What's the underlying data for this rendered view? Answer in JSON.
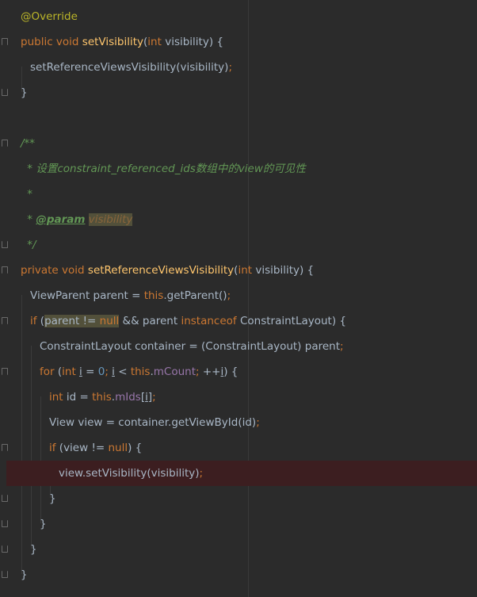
{
  "lines": [
    {
      "tokens": [
        {
          "t": "@Override",
          "c": "ann"
        }
      ]
    },
    {
      "tokens": [
        {
          "t": "public ",
          "c": "kw"
        },
        {
          "t": "void ",
          "c": "kw"
        },
        {
          "t": "setVisibility",
          "c": "fn"
        },
        {
          "t": "(",
          "c": ""
        },
        {
          "t": "int ",
          "c": "kw"
        },
        {
          "t": "visibility) {",
          "c": ""
        }
      ]
    },
    {
      "tokens": [
        {
          "t": "setReferenceViewsVisibility(visibility)",
          "c": ""
        },
        {
          "t": ";",
          "c": "kw"
        }
      ]
    },
    {
      "tokens": [
        {
          "t": "}",
          "c": ""
        }
      ]
    },
    {
      "tokens": []
    },
    {
      "tokens": [
        {
          "t": "/**",
          "c": "doc"
        }
      ]
    },
    {
      "tokens": [
        {
          "t": " * 设置constraint_referenced_ids数组中的view的可见性",
          "c": "doc"
        }
      ]
    },
    {
      "tokens": [
        {
          "t": " *",
          "c": "doc"
        }
      ]
    },
    {
      "tokens": [
        {
          "t": " * ",
          "c": "doc"
        },
        {
          "t": "@param",
          "c": "doctag"
        },
        {
          "t": " ",
          "c": "doc"
        },
        {
          "t": "visibility",
          "c": "docval hl"
        }
      ]
    },
    {
      "tokens": [
        {
          "t": " */",
          "c": "doc"
        }
      ]
    },
    {
      "tokens": [
        {
          "t": "private ",
          "c": "kw"
        },
        {
          "t": "void ",
          "c": "kw"
        },
        {
          "t": "setReferenceViewsVisibility",
          "c": "fn"
        },
        {
          "t": "(",
          "c": ""
        },
        {
          "t": "int ",
          "c": "kw"
        },
        {
          "t": "visibility) {",
          "c": ""
        }
      ]
    },
    {
      "tokens": [
        {
          "t": "ViewParent parent = ",
          "c": ""
        },
        {
          "t": "this",
          "c": "kw"
        },
        {
          "t": ".getParent()",
          "c": ""
        },
        {
          "t": ";",
          "c": "kw"
        }
      ]
    },
    {
      "tokens": [
        {
          "t": "if ",
          "c": "kw"
        },
        {
          "t": "(",
          "c": ""
        },
        {
          "t": "parent != ",
          "c": "hl"
        },
        {
          "t": "null",
          "c": "kw hl"
        },
        {
          "t": " && parent ",
          "c": ""
        },
        {
          "t": "instanceof ",
          "c": "kw"
        },
        {
          "t": "ConstraintLayout) {",
          "c": ""
        }
      ]
    },
    {
      "tokens": [
        {
          "t": "ConstraintLayout container = (ConstraintLayout) parent",
          "c": ""
        },
        {
          "t": ";",
          "c": "kw"
        }
      ]
    },
    {
      "tokens": [
        {
          "t": "for ",
          "c": "kw"
        },
        {
          "t": "(",
          "c": ""
        },
        {
          "t": "int ",
          "c": "kw"
        },
        {
          "t": "i",
          "c": "ul"
        },
        {
          "t": " = ",
          "c": ""
        },
        {
          "t": "0",
          "c": "num"
        },
        {
          "t": "; ",
          "c": "kw"
        },
        {
          "t": "i",
          "c": "ul"
        },
        {
          "t": " < ",
          "c": ""
        },
        {
          "t": "this",
          "c": "kw"
        },
        {
          "t": ".",
          "c": ""
        },
        {
          "t": "mCount",
          "c": "field"
        },
        {
          "t": "; ",
          "c": "kw"
        },
        {
          "t": "++",
          "c": ""
        },
        {
          "t": "i",
          "c": "ul"
        },
        {
          "t": ") {",
          "c": ""
        }
      ]
    },
    {
      "tokens": [
        {
          "t": "int ",
          "c": "kw"
        },
        {
          "t": "id = ",
          "c": ""
        },
        {
          "t": "this",
          "c": "kw"
        },
        {
          "t": ".",
          "c": ""
        },
        {
          "t": "mIds",
          "c": "field"
        },
        {
          "t": "[",
          "c": ""
        },
        {
          "t": "i",
          "c": "ul"
        },
        {
          "t": "]",
          "c": ""
        },
        {
          "t": ";",
          "c": "kw"
        }
      ]
    },
    {
      "tokens": [
        {
          "t": "View view = container.getViewById(id)",
          "c": ""
        },
        {
          "t": ";",
          "c": "kw"
        }
      ]
    },
    {
      "tokens": [
        {
          "t": "if ",
          "c": "kw"
        },
        {
          "t": "(view != ",
          "c": ""
        },
        {
          "t": "null",
          "c": "kw"
        },
        {
          "t": ") {",
          "c": ""
        }
      ]
    },
    {
      "tokens": [
        {
          "t": "view.setVisibility(visibility)",
          "c": ""
        },
        {
          "t": ";",
          "c": "kw"
        }
      ]
    },
    {
      "tokens": [
        {
          "t": "}",
          "c": ""
        }
      ]
    },
    {
      "tokens": [
        {
          "t": "}",
          "c": ""
        }
      ]
    },
    {
      "tokens": [
        {
          "t": "}",
          "c": ""
        }
      ]
    },
    {
      "tokens": [
        {
          "t": "}",
          "c": ""
        }
      ]
    }
  ],
  "colors": {
    "background": "#2b2b2b",
    "keyword": "#cc7832",
    "method": "#ffc66d",
    "annotation": "#bbb529",
    "doc_comment": "#629755",
    "number": "#6897bb",
    "field": "#9876aa",
    "default_text": "#a9b7c6",
    "error_line": "#3c1e20"
  }
}
